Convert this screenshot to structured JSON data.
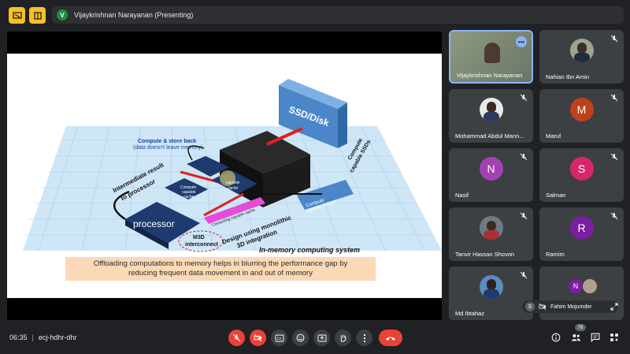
{
  "topbar": {
    "presenter": "Vijaykrishnan Narayanan (Presenting)",
    "presenter_initial": "V"
  },
  "slide": {
    "labels": {
      "compute_store": "Compute & store back",
      "compute_store_sub": "(data doesn't leave memory)",
      "intermediate": "Intermediate result",
      "intermediate_sub": "to processor",
      "processor": "processor",
      "m3d": "M3D",
      "m3d_sub": "interconnect",
      "design": "Design using monolithic",
      "design_sub": "3D integration",
      "ssd": "SSD/Disk",
      "compute_ssd": "Compute",
      "compute_ssd_sub": "capable SSDs",
      "dram": "Compute",
      "dram_sub": "capable DRAM",
      "cache1": "Compute",
      "cache1_sub": "capable",
      "cache1_sub2": "cache",
      "cache2": "capable",
      "cache2_sub": "cache",
      "cache_bar": "Computing capable cache",
      "system": "In-memory computing system"
    },
    "caption_line1": "Offloading computations to memory helps in blurring the performance gap by",
    "caption_line2": "reducing frequent data movement in and out of memory"
  },
  "participants": [
    {
      "name": "Vijaykrishnan Narayanan",
      "type": "video"
    },
    {
      "name": "Nahian Ibn Amin",
      "type": "photo"
    },
    {
      "name": "Mohammad Abdul Mann...",
      "type": "photo"
    },
    {
      "name": "Maruf",
      "type": "letter",
      "letter": "M",
      "color": "#c1401c"
    },
    {
      "name": "Nasif",
      "type": "letter",
      "letter": "N",
      "color": "#a142b3"
    },
    {
      "name": "Salman",
      "type": "letter",
      "letter": "S",
      "color": "#d5286b"
    },
    {
      "name": "Tanvir Hassan Shovon",
      "type": "photo"
    },
    {
      "name": "Ramim",
      "type": "letter",
      "letter": "R",
      "color": "#7b1fa2"
    },
    {
      "name": "Md Ibtahaz",
      "type": "photo"
    },
    {
      "name": "Fahim Mojumder",
      "type": "group",
      "letter": "N",
      "color": "#7b1fa2"
    }
  ],
  "fahim_initial": "S",
  "bottombar": {
    "time": "06:35",
    "separator": "|",
    "meeting_code": "ecj-hdhr-dhr",
    "participant_count": "76"
  },
  "colors": {
    "background": "#202124",
    "tile": "#3c4043",
    "danger": "#ea4335",
    "accent": "#8ab4f8"
  }
}
